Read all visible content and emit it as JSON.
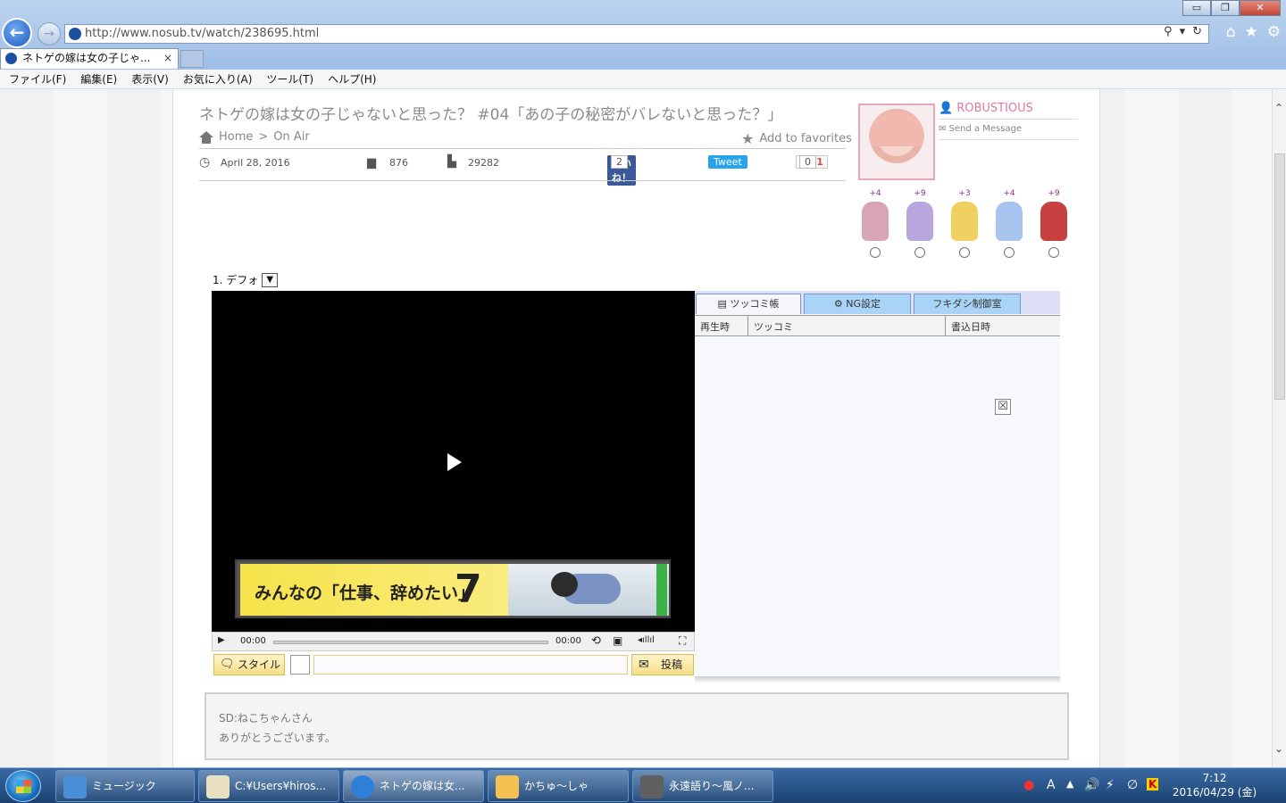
{
  "browser": {
    "url": "http://www.nosub.tv/watch/238695.html",
    "tab_title": "ネトゲの嫁は女の子じゃ...",
    "tab_close": "×",
    "window_controls": [
      "▭",
      "❐",
      "✕"
    ],
    "menu": [
      "ファイル(F)",
      "編集(E)",
      "表示(V)",
      "お気に入り(A)",
      "ツール(T)",
      "ヘルプ(H)"
    ]
  },
  "page": {
    "title": "ネトゲの嫁は女の子じゃないと思った？ #04「あの子の秘密がバレないと思った？」",
    "breadcrumb": {
      "home": "Home",
      "sep": ">",
      "current": "On Air"
    },
    "add_favorites": "Add to favorites",
    "date": "April 28, 2016",
    "comments": "876",
    "views": "29282",
    "share": {
      "fb_label": "いいね！",
      "fb_count": "2",
      "tweet_label": "Tweet",
      "gplus_label": "G+1",
      "gplus_count": "0"
    },
    "user": {
      "name": "ROBUSTIOUS",
      "send_message": "Send a Message"
    },
    "chibis": [
      {
        "points": "+4",
        "color": "#d8a4b8"
      },
      {
        "points": "+9",
        "color": "#b8a6de"
      },
      {
        "points": "+3",
        "color": "#f0d060"
      },
      {
        "points": "+4",
        "color": "#a6c4ee"
      },
      {
        "points": "+9",
        "color": "#c84040"
      }
    ]
  },
  "player": {
    "preset_label": "1. デフォ",
    "time_current": "00:00",
    "time_total": "00:00",
    "ad_text": "みんなの「仕事、辞めたい」",
    "ad_number": "7",
    "style_button": "スタイル",
    "comment_placeholder": "",
    "post_button": "投稿"
  },
  "comment_panel": {
    "tabs": [
      "ツッコミ帳",
      "NG設定",
      "フキダシ制御室"
    ],
    "columns": [
      "再生時",
      "ツッコミ",
      "書込日時"
    ],
    "close_icon": "☒"
  },
  "description": {
    "line1": "SD:ねこちゃんさん",
    "line2": "ありがとうございます。"
  },
  "taskbar": {
    "buttons": [
      {
        "label": "ミュージック",
        "color": "#4a8fd6"
      },
      {
        "label": "C:¥Users¥hiros...",
        "color": "#e8e0c0"
      },
      {
        "label": "ネトゲの嫁は女...",
        "color": "#2f7fd8"
      },
      {
        "label": "かちゅ～しゃ",
        "color": "#f4c050"
      },
      {
        "label": "永遠語り～風ノ...",
        "color": "#606060"
      }
    ],
    "ime": "A",
    "time": "7:12",
    "date": "2016/04/29 (金)"
  }
}
